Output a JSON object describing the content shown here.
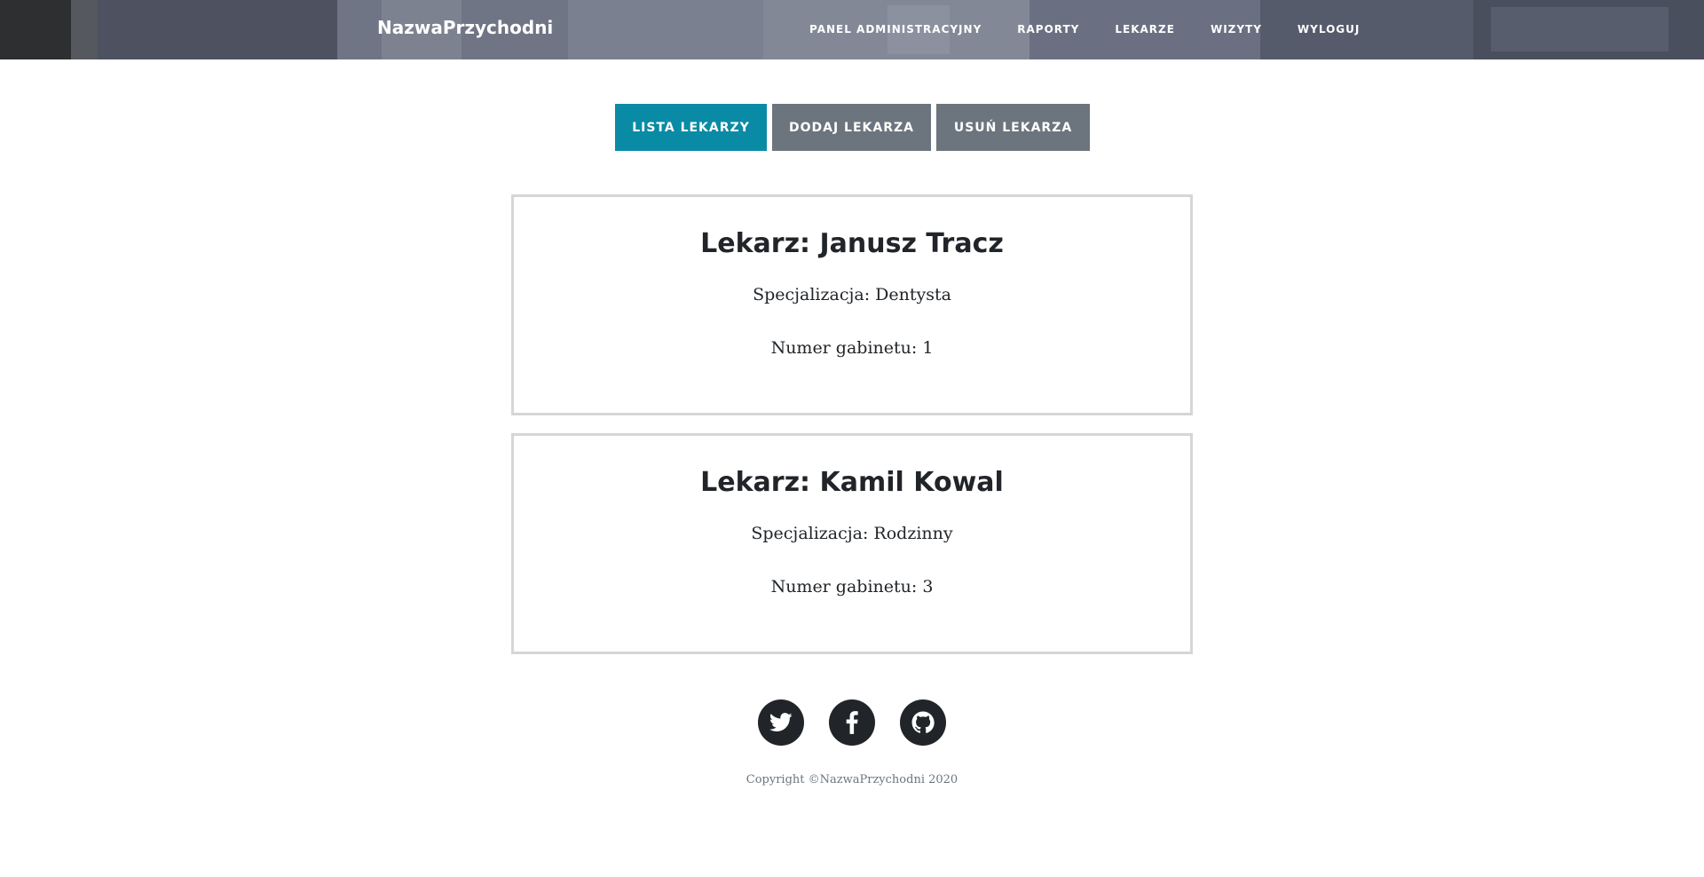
{
  "header": {
    "brand": "NazwaPrzychodni",
    "nav": [
      {
        "label": "Panel administracyjny"
      },
      {
        "label": "Raporty"
      },
      {
        "label": "Lekarze"
      },
      {
        "label": "Wizyty"
      },
      {
        "label": "Wyloguj"
      }
    ]
  },
  "tabs": [
    {
      "label": "Lista lekarzy",
      "active": true
    },
    {
      "label": "Dodaj lekarza",
      "active": false
    },
    {
      "label": "Usuń lekarza",
      "active": false
    }
  ],
  "doctors": [
    {
      "title": "Lekarz: Janusz Tracz",
      "specialization": "Specjalizacja: Dentysta",
      "room": "Numer gabinetu: 1"
    },
    {
      "title": "Lekarz: Kamil Kowal",
      "specialization": "Specjalizacja: Rodzinny",
      "room": "Numer gabinetu: 3"
    }
  ],
  "footer": {
    "social": [
      {
        "icon": "twitter-icon"
      },
      {
        "icon": "facebook-icon"
      },
      {
        "icon": "github-icon"
      }
    ],
    "copyright": "Copyright ©NazwaPrzychodni 2020"
  },
  "colors": {
    "accent": "#0a8ba5",
    "secondary": "#6c757d",
    "dark": "#212529",
    "card_border": "#d6d6d6"
  }
}
